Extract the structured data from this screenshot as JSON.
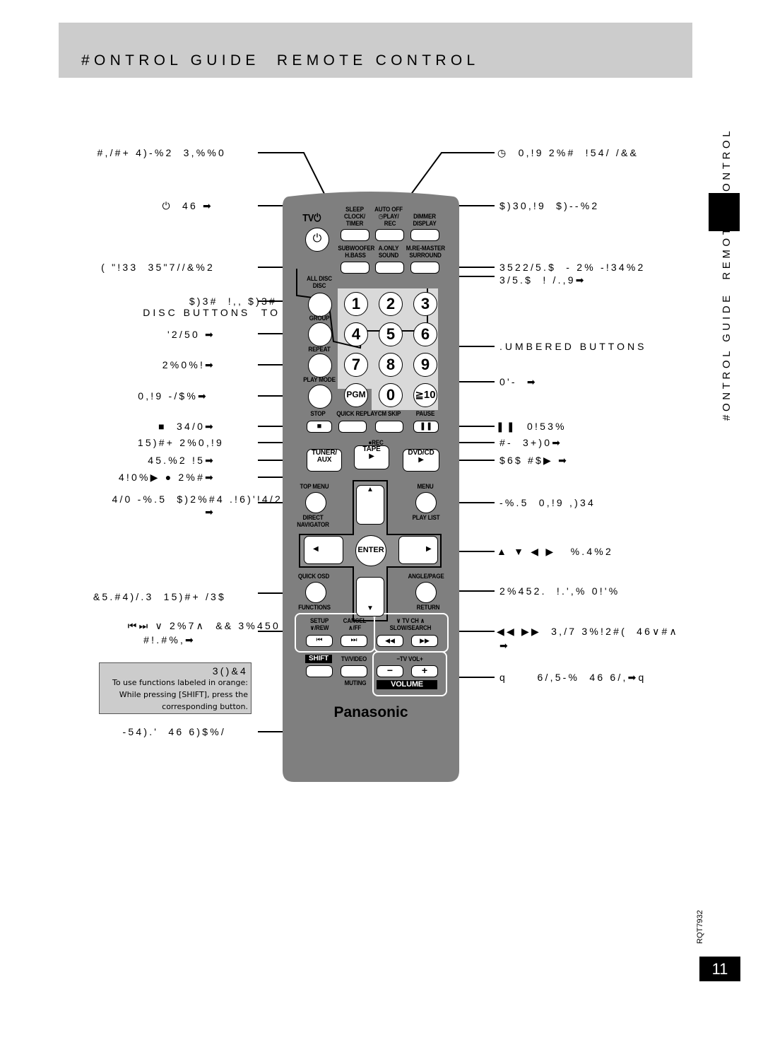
{
  "header": {
    "title": "#ONTROL GUIDE  REMOTE CONTROL"
  },
  "side_tab": {
    "text": "#ONTROL GUIDE  REMOTE  CONTROL"
  },
  "footer": {
    "doc_code": "RQT7932",
    "page_number": "11"
  },
  "shift_note": {
    "title": "3()&4",
    "lines": [
      "To use functions labeled in orange:",
      "While pressing [SHIFT], press the",
      "corresponding button."
    ]
  },
  "left_labels": [
    "#,/#+ 4)-%2  3,%%0",
    "⏻  46 ➡",
    "( \"!33  35\"7//&%2",
    "$)3#  !,, $)3#",
    "DISC BUTTONS  TO",
    "'2/50 ➡",
    "2%0%!➡",
    "0,!9 -/$%➡",
    "■  34/0➡",
    "15)#+ 2%0,!9",
    "45.%2 !5➡",
    "4!0%▶ ● 2%#➡",
    "4/0 -%.5  $)2%#4 .!6)'!4/2",
    "➡",
    "&5.#4)/.3  15)#+ /3$",
    "⏮⏭ ∨ 2%7∧  && 3%450",
    "#!.#%,➡",
    "-54).'  46 6)$%/"
  ],
  "right_labels": [
    "◷  0,!9 2%#  !54/ /&&",
    "$)30,!9  $)--%2",
    "3522/5.$  - 2% -!34%2",
    "3/5.$  ! /.,9➡",
    ".UMBERED BUTTONS",
    "0'-  ➡",
    "❚❚  0!53%",
    "#-  3+)0➡",
    "$6$ #$▶ ➡",
    "-%.5  0,!9 ,)34",
    "▲ ▼ ◀ ▶   %.4%2",
    "2%452.  !.',% 0!'%",
    "◀◀ ▶▶  3,/7 3%!2#(  46∨#∧",
    "➡",
    "q      6/,5-%  46 6/,➡q"
  ],
  "remote": {
    "brand": "Panasonic",
    "tv_power_label": "TV⏻",
    "power_icon": "⏻",
    "top_buttons": [
      {
        "label": "SLEEP\nCLOCK/\nTIMER"
      },
      {
        "label": "AUTO OFF\n◷PLAY/\n  REC"
      },
      {
        "label": "DIMMER\nDISPLAY"
      },
      {
        "label": "SUBWOOFER\nH.BASS"
      },
      {
        "label": "A.ONLY\nSOUND"
      },
      {
        "label": "M.RE-MASTER\nSURROUND"
      }
    ],
    "side_buttons": [
      {
        "label": "ALL DISC\nDISC"
      },
      {
        "label": "GROUP"
      },
      {
        "label": "REPEAT"
      },
      {
        "label": "PLAY MODE"
      }
    ],
    "numbers": [
      "1",
      "2",
      "3",
      "4",
      "5",
      "6",
      "7",
      "8",
      "9",
      "PGM",
      "0",
      "≧10"
    ],
    "row_buttons": [
      {
        "label": "STOP",
        "glyph": "■"
      },
      {
        "label": "QUICK REPLAY",
        "glyph": ""
      },
      {
        "label": "CM SKIP",
        "glyph": ""
      },
      {
        "label": "PAUSE",
        "glyph": "❚❚"
      }
    ],
    "rec_label": "●REC",
    "source_buttons": [
      {
        "label": "TUNER/\nAUX"
      },
      {
        "label": "TAPE\n▶"
      },
      {
        "label": "DVD/CD\n▶"
      }
    ],
    "top_menu_label": "TOP MENU",
    "direct_nav_label": "DIRECT\nNAVIGATOR",
    "menu_label": "MENU",
    "play_list_label": "PLAY LIST",
    "up_glyph": "▲",
    "down_glyph": "▼",
    "left_glyph": "◀",
    "right_glyph": "▶",
    "enter_label": "ENTER",
    "quick_osd_label": "QUICK OSD",
    "functions_label": "FUNCTIONS",
    "angle_page_label": "ANGLE/PAGE",
    "return_label": "RETURN",
    "skip_labels": [
      "SETUP\n∨/REW",
      "CANCEL\n∧/FF"
    ],
    "skip_glyphs": [
      "⏮",
      "⏭"
    ],
    "search_label": "∨ TV CH ∧\nSLOW/SEARCH",
    "search_glyphs": [
      "◀◀",
      "▶▶"
    ],
    "shift_label": "SHIFT",
    "tv_video_label": "TV/VIDEO",
    "muting_label": "MUTING",
    "tv_vol_label": "−TV VOL+",
    "vol_minus": "−",
    "vol_plus": "+",
    "volume_label": "VOLUME"
  }
}
